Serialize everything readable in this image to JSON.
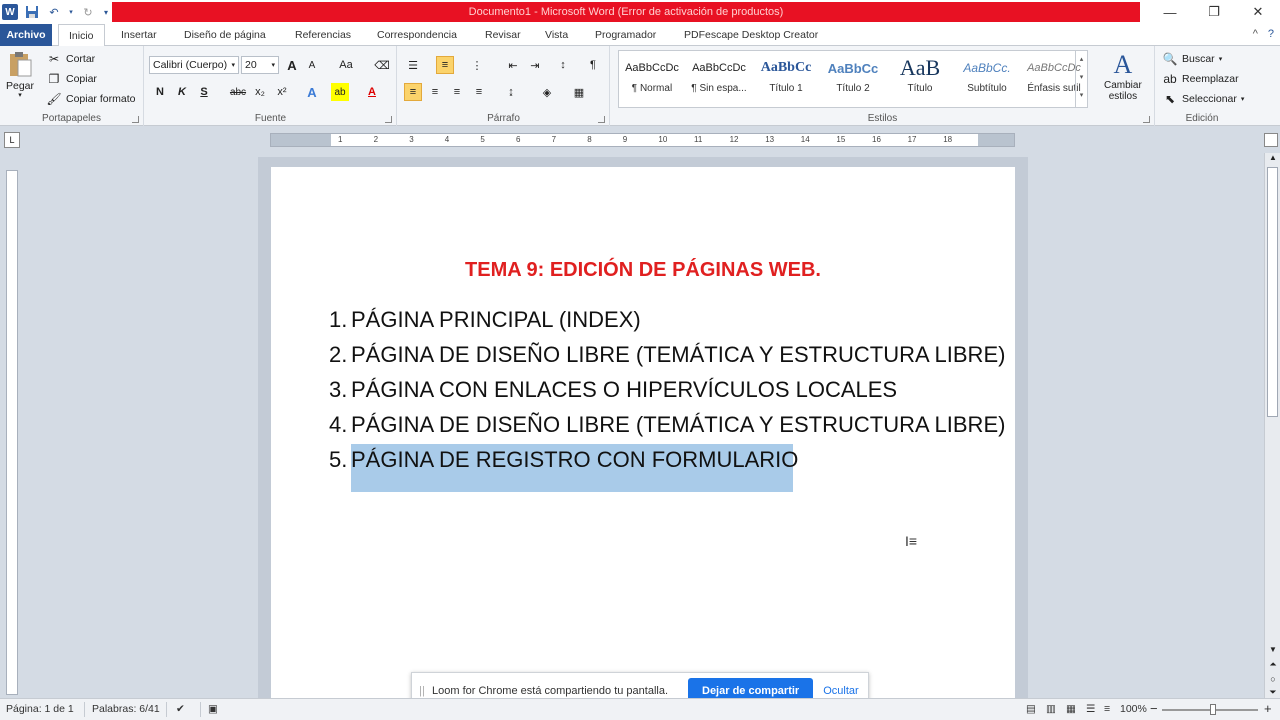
{
  "window": {
    "title": "Documento1  -  Microsoft Word (Error de activación de productos)"
  },
  "tabs": {
    "archivo": "Archivo",
    "items": [
      "Inicio",
      "Insertar",
      "Diseño de página",
      "Referencias",
      "Correspondencia",
      "Revisar",
      "Vista",
      "Programador",
      "PDFescape Desktop Creator"
    ],
    "active": "Inicio"
  },
  "ribbon": {
    "portapapeles": {
      "label": "Portapapeles",
      "pegar": "Pegar",
      "cortar": "Cortar",
      "copiar": "Copiar",
      "copiar_formato": "Copiar formato"
    },
    "fuente": {
      "label": "Fuente",
      "font_name": "Calibri (Cuerpo)",
      "font_size": "20",
      "grow": "A",
      "shrink": "A",
      "case": "Aa",
      "bold": "N",
      "italic": "K",
      "underline": "S",
      "strike": "abc",
      "sub": "x₂",
      "sup": "x²"
    },
    "parrafo": {
      "label": "Párrafo"
    },
    "estilos": {
      "label": "Estilos",
      "items": [
        {
          "preview": "AaBbCcDc",
          "name": "¶ Normal"
        },
        {
          "preview": "AaBbCcDc",
          "name": "¶ Sin espa..."
        },
        {
          "preview": "AaBbCc",
          "name": "Título 1"
        },
        {
          "preview": "AaBbCc",
          "name": "Título 2"
        },
        {
          "preview": "AaB",
          "name": "Título"
        },
        {
          "preview": "AaBbCc.",
          "name": "Subtítulo"
        },
        {
          "preview": "AaBbCcDc",
          "name": "Énfasis sutil"
        }
      ],
      "cambiar_estilos_1": "Cambiar",
      "cambiar_estilos_2": "estilos"
    },
    "edicion": {
      "label": "Edición",
      "buscar": "Buscar",
      "reemplazar": "Reemplazar",
      "seleccionar": "Seleccionar"
    }
  },
  "document": {
    "title": "TEMA 9: EDICIÓN DE PÁGINAS WEB.",
    "items": [
      {
        "num": "1.",
        "text": "PÁGINA PRINCIPAL (INDEX)"
      },
      {
        "num": "2.",
        "text": "PÁGINA DE DISEÑO LIBRE (TEMÁTICA Y ESTRUCTURA LIBRE)"
      },
      {
        "num": "3.",
        "text": "PÁGINA CON ENLACES O HIPERVÍCULOS LOCALES"
      },
      {
        "num": "4.",
        "text": "PÁGINA DE DISEÑO LIBRE (TEMÁTICA Y ESTRUCTURA LIBRE)"
      },
      {
        "num": "5.",
        "text": "PÁGINA DE REGISTRO CON  FORMULARIO"
      }
    ]
  },
  "loom": {
    "message": "Loom for Chrome está compartiendo tu pantalla.",
    "stop": "Dejar de compartir",
    "hide": "Ocultar"
  },
  "statusbar": {
    "page": "Página: 1 de 1",
    "words": "Palabras: 6/41",
    "zoom": "100%"
  },
  "colors": {
    "title_red": "#e02020",
    "selection": "#a9cbe9",
    "archivo_tab": "#2a5699",
    "loom_button": "#1a73e8"
  }
}
